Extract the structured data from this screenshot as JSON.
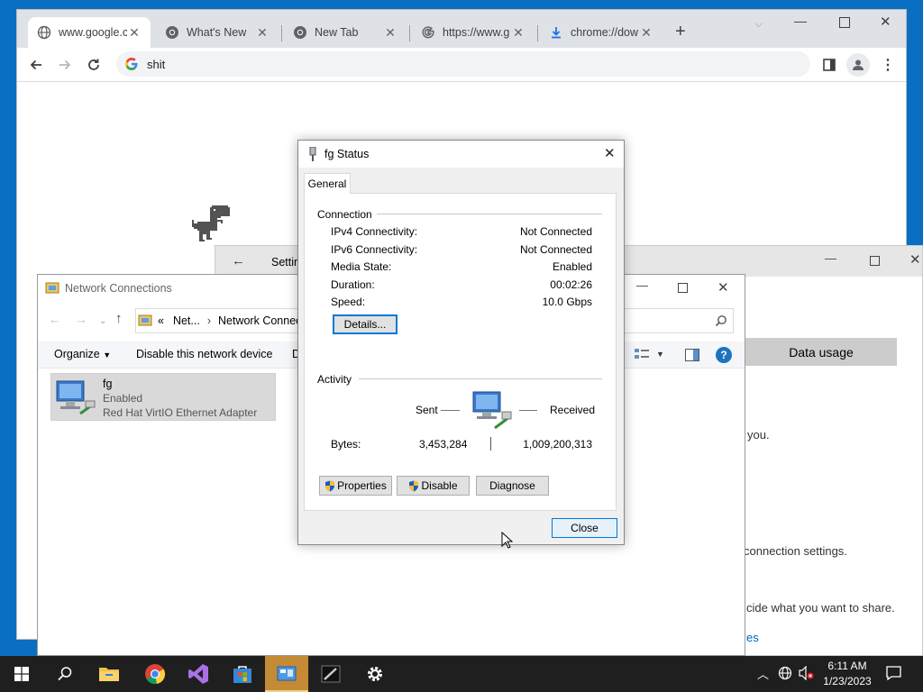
{
  "chrome": {
    "tabs": [
      {
        "title": "www.google.c",
        "icon": "globe-icon"
      },
      {
        "title": "What's New",
        "icon": "chrome-icon"
      },
      {
        "title": "New Tab",
        "icon": "chrome-icon"
      },
      {
        "title": "https://www.g",
        "icon": "google-g-icon"
      },
      {
        "title": "chrome://dow",
        "icon": "download-icon"
      }
    ],
    "omnibox_text": "shit"
  },
  "settings": {
    "title": "Settin",
    "data_usage": "Data usage",
    "text1": "you.",
    "text2": "connection settings.",
    "text3": "cide what you want to share.",
    "text4": "es"
  },
  "netconn": {
    "title": "Network Connections",
    "breadcrumb_chevrons": "«",
    "breadcrumb1": "Net...",
    "breadcrumb2": "Network Connec",
    "organize": "Organize",
    "disable_device": "Disable this network device",
    "cut_label": "D",
    "adapter": {
      "name": "fg",
      "status": "Enabled",
      "device": "Red Hat VirtIO Ethernet Adapter"
    }
  },
  "dialog": {
    "title": "fg Status",
    "tab": "General",
    "connection_label": "Connection",
    "fields": [
      {
        "label": "IPv4 Connectivity:",
        "value": "Not Connected"
      },
      {
        "label": "IPv6 Connectivity:",
        "value": "Not Connected"
      },
      {
        "label": "Media State:",
        "value": "Enabled"
      },
      {
        "label": "Duration:",
        "value": "00:02:26"
      },
      {
        "label": "Speed:",
        "value": "10.0 Gbps"
      }
    ],
    "details_btn": "Details...",
    "activity_label": "Activity",
    "sent_label": "Sent",
    "received_label": "Received",
    "bytes_label": "Bytes:",
    "bytes_sent": "3,453,284",
    "bytes_received": "1,009,200,313",
    "properties_btn": "Properties",
    "disable_btn": "Disable",
    "diagnose_btn": "Diagnose",
    "close_btn": "Close"
  },
  "taskbar": {
    "time": "6:11 AM",
    "date": "1/23/2023"
  },
  "colors": {
    "desktop": "#0a6fc2",
    "taskbar": "#1f1f1f",
    "active_taskbar_item": "#c58a35",
    "help_blue": "#1e73be"
  }
}
